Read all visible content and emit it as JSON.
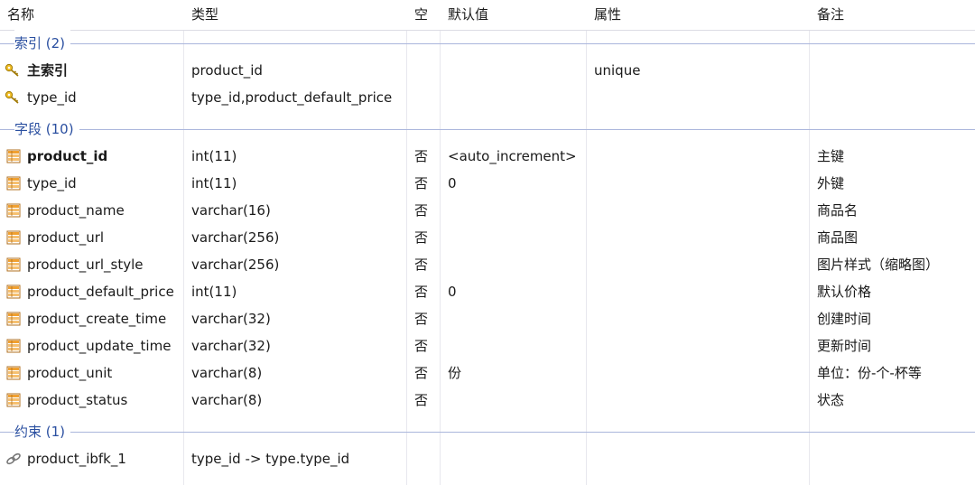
{
  "columns": [
    "名称",
    "类型",
    "空",
    "默认值",
    "属性",
    "备注"
  ],
  "indexes": {
    "label": "索引 (2)",
    "items": [
      {
        "name": "主索引",
        "type": "product_id",
        "nullable": "",
        "default": "",
        "attr": "unique",
        "comment": "",
        "bold": true,
        "icon": "key-icon"
      },
      {
        "name": "type_id",
        "type": "type_id,product_default_price",
        "nullable": "",
        "default": "",
        "attr": "",
        "comment": "",
        "bold": false,
        "icon": "key-icon"
      }
    ]
  },
  "fields": {
    "label": "字段 (10)",
    "items": [
      {
        "name": "product_id",
        "type": "int(11)",
        "nullable": "否",
        "default": "<auto_increment>",
        "attr": "",
        "comment": "主键",
        "bold": true,
        "icon": "field-icon"
      },
      {
        "name": "type_id",
        "type": "int(11)",
        "nullable": "否",
        "default": "0",
        "attr": "",
        "comment": "外键",
        "bold": false,
        "icon": "field-icon"
      },
      {
        "name": "product_name",
        "type": "varchar(16)",
        "nullable": "否",
        "default": "",
        "attr": "",
        "comment": "商品名",
        "bold": false,
        "icon": "field-icon"
      },
      {
        "name": "product_url",
        "type": "varchar(256)",
        "nullable": "否",
        "default": "",
        "attr": "",
        "comment": "商品图",
        "bold": false,
        "icon": "field-icon"
      },
      {
        "name": "product_url_style",
        "type": "varchar(256)",
        "nullable": "否",
        "default": "",
        "attr": "",
        "comment": "图片样式（缩略图）",
        "bold": false,
        "icon": "field-icon"
      },
      {
        "name": "product_default_price",
        "type": "int(11)",
        "nullable": "否",
        "default": "0",
        "attr": "",
        "comment": "默认价格",
        "bold": false,
        "icon": "field-icon"
      },
      {
        "name": "product_create_time",
        "type": "varchar(32)",
        "nullable": "否",
        "default": "",
        "attr": "",
        "comment": "创建时间",
        "bold": false,
        "icon": "field-icon"
      },
      {
        "name": "product_update_time",
        "type": "varchar(32)",
        "nullable": "否",
        "default": "",
        "attr": "",
        "comment": "更新时间",
        "bold": false,
        "icon": "field-icon"
      },
      {
        "name": "product_unit",
        "type": "varchar(8)",
        "nullable": "否",
        "default": "份",
        "attr": "",
        "comment": "单位：份-个-杯等",
        "bold": false,
        "icon": "field-icon"
      },
      {
        "name": "product_status",
        "type": "varchar(8)",
        "nullable": "否",
        "default": "",
        "attr": "",
        "comment": "状态",
        "bold": false,
        "icon": "field-icon"
      }
    ]
  },
  "constraints": {
    "label": "约束 (1)",
    "items": [
      {
        "name": "product_ibfk_1",
        "type": "type_id -> type.type_id",
        "nullable": "",
        "default": "",
        "attr": "",
        "comment": "",
        "bold": false,
        "icon": "link-icon"
      }
    ]
  },
  "colors": {
    "group_text": "#2a4fa0",
    "group_line": "#aab6dc",
    "key": "#e0a800",
    "field_orange": "#f0a030"
  }
}
